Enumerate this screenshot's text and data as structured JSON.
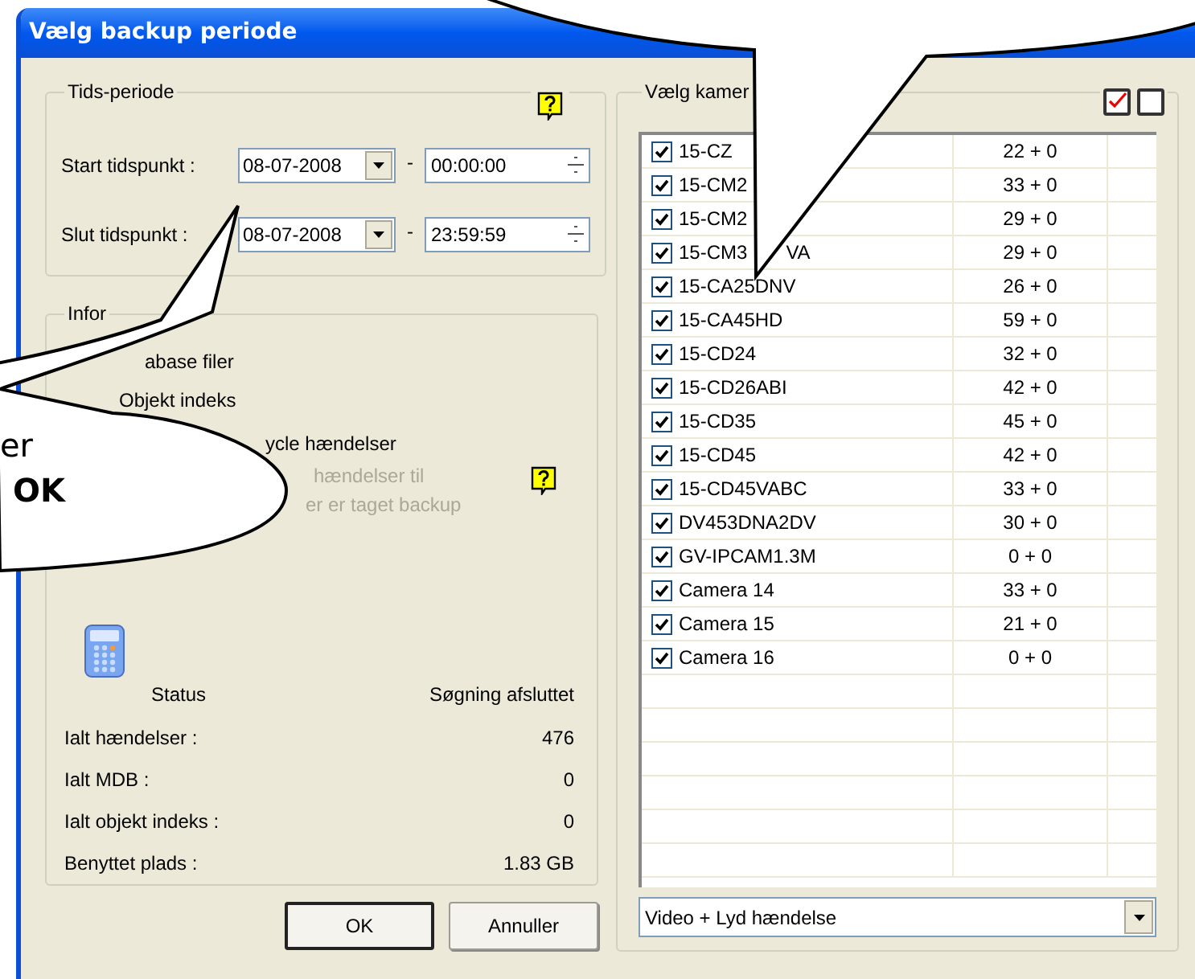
{
  "window": {
    "title": "Vælg backup periode"
  },
  "time_period": {
    "title": "Tids-periode",
    "rows": [
      {
        "label": "Start tidspunkt :",
        "date": "08-07-2008",
        "separator": "-",
        "time": "00:00:00"
      },
      {
        "label": "Slut tidspunkt :",
        "date": "08-07-2008",
        "separator": "-",
        "time": "23:59:59"
      }
    ]
  },
  "info": {
    "title": "Infor",
    "options": [
      {
        "text": "abase filer",
        "disabled": false
      },
      {
        "text": "Objekt indeks",
        "disabled": false
      },
      {
        "text": "ycle hændelser",
        "disabled": false
      },
      {
        "text": "hændelser til",
        "disabled": true
      },
      {
        "text": "er er taget backup",
        "disabled": true
      }
    ],
    "status": {
      "label": "Status",
      "value": "Søgning afsluttet"
    },
    "stats": [
      {
        "label": "Ialt hændelser :",
        "value": "476"
      },
      {
        "label": "Ialt MDB :",
        "value": "0"
      },
      {
        "label": "Ialt objekt indeks :",
        "value": "0"
      },
      {
        "label": "Benyttet plads :",
        "value": "1.83 GB"
      }
    ]
  },
  "buttons": [
    {
      "label": "OK",
      "default": true
    },
    {
      "label": "Annuller",
      "default": false
    }
  ],
  "cameras": {
    "title": "Vælg kamer",
    "rows": [
      {
        "name": "15-CZ",
        "count": "22 + 0",
        "checked": true
      },
      {
        "name": "15-CM2",
        "count": "33 + 0",
        "checked": true
      },
      {
        "name": "15-CM2",
        "count": "29 + 0",
        "checked": true
      },
      {
        "name": "15-CM3",
        "name_tail": "VA",
        "count": "29 + 0",
        "checked": true
      },
      {
        "name": "15-CA25DNV",
        "count": "26 + 0",
        "checked": true
      },
      {
        "name": "15-CA45HD",
        "count": "59 + 0",
        "checked": true
      },
      {
        "name": "15-CD24",
        "count": "32 + 0",
        "checked": true
      },
      {
        "name": "15-CD26ABI",
        "count": "42 + 0",
        "checked": true
      },
      {
        "name": "15-CD35",
        "count": "45 + 0",
        "checked": true
      },
      {
        "name": "15-CD45",
        "count": "42 + 0",
        "checked": true
      },
      {
        "name": "15-CD45VABC",
        "count": "33 + 0",
        "checked": true
      },
      {
        "name": "DV453DNA2DV",
        "count": "30 + 0",
        "checked": true
      },
      {
        "name": "GV-IPCAM1.3M",
        "count": "0 + 0",
        "checked": true
      },
      {
        "name": "Camera 14",
        "count": "33 + 0",
        "checked": true
      },
      {
        "name": "Camera 15",
        "count": "21 + 0",
        "checked": true
      },
      {
        "name": "Camera 16",
        "count": "0 + 0",
        "checked": true
      }
    ]
  },
  "filter": {
    "value": "Video + Lyd hændelse"
  },
  "callout": {
    "lines": [
      {
        "text": "er",
        "bold": false
      },
      {
        "text": "OK",
        "bold": true
      }
    ]
  }
}
